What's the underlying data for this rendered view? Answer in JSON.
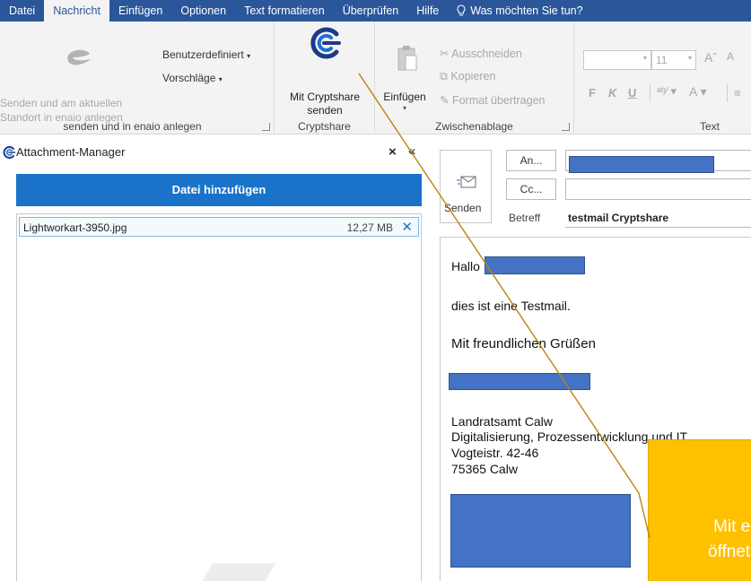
{
  "tabs": [
    "Datei",
    "Nachricht",
    "Einfügen",
    "Optionen",
    "Text formatieren",
    "Überprüfen",
    "Hilfe",
    "Was möchten Sie tun?"
  ],
  "ribbon": {
    "enaio": {
      "send_line1": "Senden und am aktuellen",
      "send_line2": "Standort in enaio anlegen",
      "custom_label": "Benutzerdefiniert",
      "suggestions_label": "Vorschläge",
      "group_label": "senden und in enaio anlegen"
    },
    "cryptshare": {
      "send_line1": "Mit Cryptshare",
      "send_line2": "senden",
      "group_label": "Cryptshare"
    },
    "clipboard": {
      "paste_label": "Einfügen",
      "cut_label": "Ausschneiden",
      "copy_label": "Kopieren",
      "format_label": "Format übertragen",
      "group_label": "Zwischenablage"
    },
    "text": {
      "font_size": "11",
      "bold": "F",
      "italic": "K",
      "underline": "U",
      "group_label": "Text"
    }
  },
  "attachment_pane": {
    "title": "Attachment-Manager",
    "close": "×",
    "collapse": "«",
    "add_button": "Datei hinzufügen",
    "files": [
      {
        "name": "Lightworkart-3950.jpg",
        "size": "12,27 MB",
        "remove": "✕"
      }
    ]
  },
  "compose": {
    "send_label": "Senden",
    "to_button": "An...",
    "cc_button": "Cc...",
    "subject_label": "Betreff",
    "subject_value": "testmail Cryptshare",
    "body": {
      "greeting": "Hallo",
      "line1": "dies ist eine Testmail.",
      "closing": "Mit freundlichen Grüßen",
      "sig1": "Landratsamt Calw",
      "sig2": "Digitalisierung, Prozessentwicklung und IT",
      "sig3": "Vogteistr. 42-46",
      "sig4": "75365 Calw"
    }
  },
  "callout": {
    "line1": "Mit ein",
    "line2": "öffnet s"
  },
  "colors": {
    "ribbon_blue": "#2b579a",
    "accent_blue": "#1a73c9",
    "callout_yellow": "#ffc000",
    "redaction_blue": "#4472c4"
  }
}
